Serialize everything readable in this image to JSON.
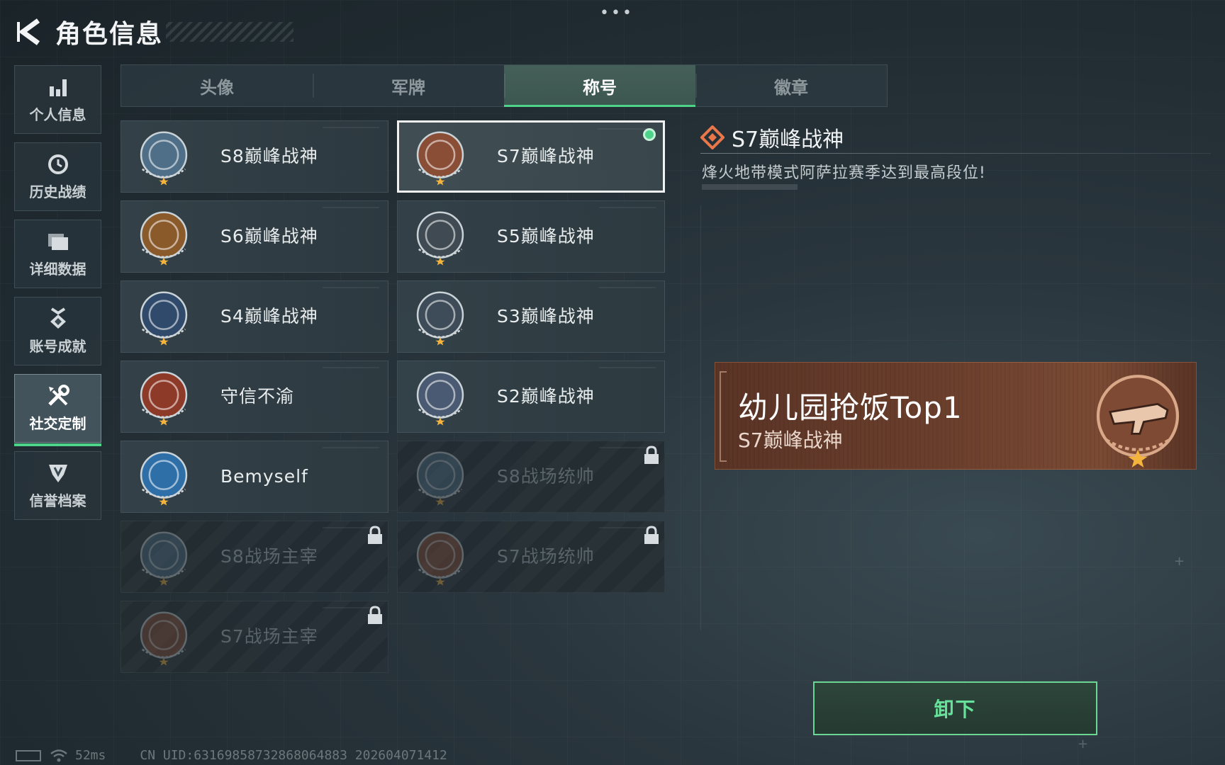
{
  "header": {
    "title": "角色信息"
  },
  "top_dots": "•••",
  "sidebar": {
    "items": [
      {
        "label": "个人信息",
        "icon": "bar-chart-icon",
        "active": false
      },
      {
        "label": "历史战绩",
        "icon": "history-clock-icon",
        "active": false
      },
      {
        "label": "详细数据",
        "icon": "folder-data-icon",
        "active": false
      },
      {
        "label": "账号成就",
        "icon": "achievement-medal-icon",
        "active": false
      },
      {
        "label": "社交定制",
        "icon": "tools-wrench-icon",
        "active": true
      },
      {
        "label": "信誉档案",
        "icon": "shield-credit-icon",
        "active": false
      }
    ]
  },
  "tabs": [
    {
      "label": "头像",
      "active": false
    },
    {
      "label": "军牌",
      "active": false
    },
    {
      "label": "称号",
      "active": true
    },
    {
      "label": "徽章",
      "active": false
    }
  ],
  "titles": [
    {
      "name": "S8巅峰战神",
      "locked": false,
      "selected": false,
      "badge_color": "#4f6f88"
    },
    {
      "name": "S7巅峰战神",
      "locked": false,
      "selected": true,
      "equipped": true,
      "badge_color": "#8a4d35"
    },
    {
      "name": "S6巅峰战神",
      "locked": false,
      "selected": false,
      "badge_color": "#8a5a2a"
    },
    {
      "name": "S5巅峰战神",
      "locked": false,
      "selected": false,
      "badge_color": "#3f4a52"
    },
    {
      "name": "S4巅峰战神",
      "locked": false,
      "selected": false,
      "badge_color": "#2f4a6a"
    },
    {
      "name": "S3巅峰战神",
      "locked": false,
      "selected": false,
      "badge_color": "#3d4c58"
    },
    {
      "name": "守信不渝",
      "locked": false,
      "selected": false,
      "badge_color": "#8e3a28"
    },
    {
      "name": "S2巅峰战神",
      "locked": false,
      "selected": false,
      "badge_color": "#4a5a72"
    },
    {
      "name": "Bemyself",
      "locked": false,
      "selected": false,
      "badge_color": "#2e6fa8"
    },
    {
      "name": "S8战场统帅",
      "locked": true,
      "selected": false,
      "badge_color": "#4f6f88"
    },
    {
      "name": "S8战场主宰",
      "locked": true,
      "selected": false,
      "badge_color": "#4f6f88"
    },
    {
      "name": "S7战场统帅",
      "locked": true,
      "selected": false,
      "badge_color": "#8a4d35"
    },
    {
      "name": "S7战场主宰",
      "locked": true,
      "selected": false,
      "badge_color": "#8a4d35"
    }
  ],
  "detail": {
    "title": "S7巅峰战神",
    "description": "烽火地带模式阿萨拉赛季达到最高段位!",
    "banner_title": "幼儿园抢饭Top1",
    "banner_subtitle": "S7巅峰战神",
    "action_label": "卸下"
  },
  "status_bar": {
    "ping": "52ms",
    "uid_text": "CN UID:63169858732868064883 202604071412"
  },
  "colors": {
    "accent": "#4ed38b",
    "banner": "#6a3e2c"
  }
}
